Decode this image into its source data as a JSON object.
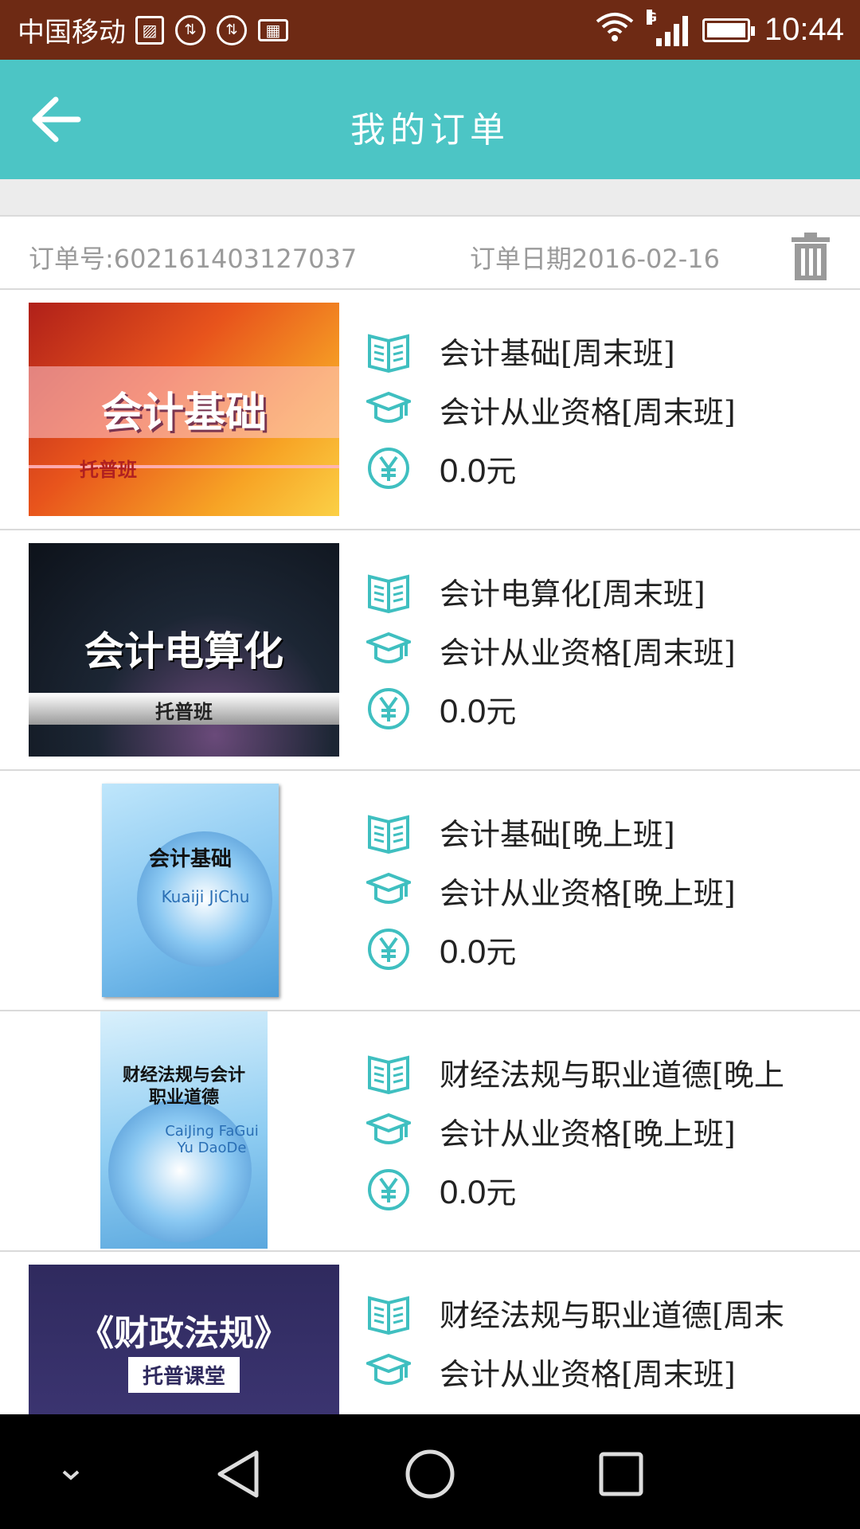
{
  "status_bar": {
    "carrier": "中国移动",
    "time": "10:44",
    "network_type": "G",
    "icons": [
      "image-icon",
      "download-icon",
      "download-icon",
      "keyboard-icon",
      "wifi-icon",
      "signal-icon",
      "battery-icon"
    ]
  },
  "header": {
    "title": "我的订单",
    "back_icon": "arrow-left-icon"
  },
  "order": {
    "number_label": "订单号:",
    "number": "602161403127037",
    "date_label": "订单日期",
    "date": "2016-02-16",
    "delete_icon": "trash-icon"
  },
  "items": [
    {
      "course": "会计基础[周末班]",
      "qualification": "会计从业资格[周末班]",
      "price": "0.0",
      "currency": "元",
      "thumb_title": "会计基础",
      "thumb_sub": "托普班"
    },
    {
      "course": "会计电算化[周末班]",
      "qualification": "会计从业资格[周末班]",
      "price": "0.0",
      "currency": "元",
      "thumb_title": "会计电算化",
      "thumb_sub": "托普班"
    },
    {
      "course": "会计基础[晚上班]",
      "qualification": "会计从业资格[晚上班]",
      "price": "0.0",
      "currency": "元",
      "thumb_title": "会计基础",
      "thumb_sub": "Kuaiji JiChu"
    },
    {
      "course": "财经法规与职业道德[晚上",
      "qualification": "会计从业资格[晚上班]",
      "price": "0.0",
      "currency": "元",
      "thumb_title": "财经法规与会计职业道德",
      "thumb_sub": "CaiJing FaGui Yu DaoDe"
    },
    {
      "course": "财经法规与职业道德[周末",
      "qualification": "会计从业资格[周末班]",
      "thumb_title": "《财政法规》",
      "thumb_sub": "托普课堂"
    }
  ],
  "nav": {
    "icons": [
      "chevron-down-icon",
      "back-triangle-icon",
      "home-circle-icon",
      "recents-square-icon"
    ]
  },
  "colors": {
    "status_bar": "#6e2a14",
    "header": "#4cc5c5",
    "accent_icon": "#3fbfc0"
  }
}
